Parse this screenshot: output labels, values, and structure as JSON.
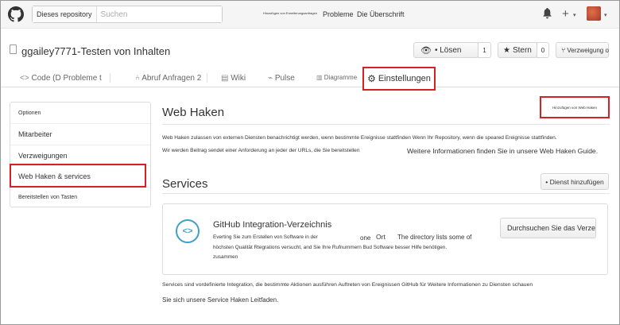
{
  "topnav": {
    "search_scope": "Dieses repository",
    "search_placeholder": "Suchen",
    "tiny_link": "Hinzufügen von Erweiterungsanfragen",
    "link_pr": "Probleme",
    "link_issues": "Die Überschrift",
    "plus": "+",
    "caret": "▾"
  },
  "repo": {
    "title": "ggailey7771-Testen von Inhalten",
    "watch_label": "• Lösen",
    "watch_count": "1",
    "star_label": "Stern",
    "star_count": "0",
    "fork_label": "Verzweigung o"
  },
  "tabs": {
    "code": "Code (D Probleme t",
    "pulls": "Abruf Anfragen 2",
    "wiki": "Wiki",
    "pulse": "Pulse",
    "graphs": "Diagramme",
    "settings": "Einstellungen"
  },
  "sidebar": {
    "items": [
      "Optionen",
      "Mitarbeiter",
      "Verzweigungen",
      "Web Haken & services",
      "Bereitstellen von Tasten"
    ]
  },
  "webhooks": {
    "title": "Web Haken",
    "add_button": "Hinzufügen von Web Haken",
    "desc_line1": "Web Haken zulassen von externen Diensten benachrichtigt werden, wenn bestimmte Ereignisse stattfinden Wenn Ihr Repository, wenn die speared Ereignisse stattfinden.",
    "desc_line2": "Wir werden Beitrag sendet einer Anforderung an jeder der URLs, die Sie bereitstellen",
    "learn_more": "Weitere Informationen finden Sie in unsere Web Haken Guide."
  },
  "services": {
    "title": "Services",
    "add_button": "• Dienst hinzufügen",
    "icon_glyph": "<>",
    "card_title": "GitHub Integration-Verzeichnis",
    "card_line1": "Everting Sie zum Erstellen von Software in der",
    "card_word_one": "one",
    "card_word_place": "Ort",
    "card_line1b": "The directory lists some of",
    "card_line2": "höchsten Qualität Rtegrations versucht, and Sie Ihre Rufnummern Bud Software besser Hilfe benötigen.",
    "card_line3": "zusammen",
    "browse_button": "Durchsuchen Sie das Verzeichnis",
    "footer_line1": "Services sind vordefinierte Integration, die bestimmte Aktionen ausführen Auftreten von Ereignissen GitHub für Weitere Informationen zu Diensten schauen",
    "footer_line2": "Sie sich unsere Service Haken Leitfaden."
  },
  "colors": {
    "highlight": "#d71f26",
    "service_icon": "#3ea0c8"
  }
}
